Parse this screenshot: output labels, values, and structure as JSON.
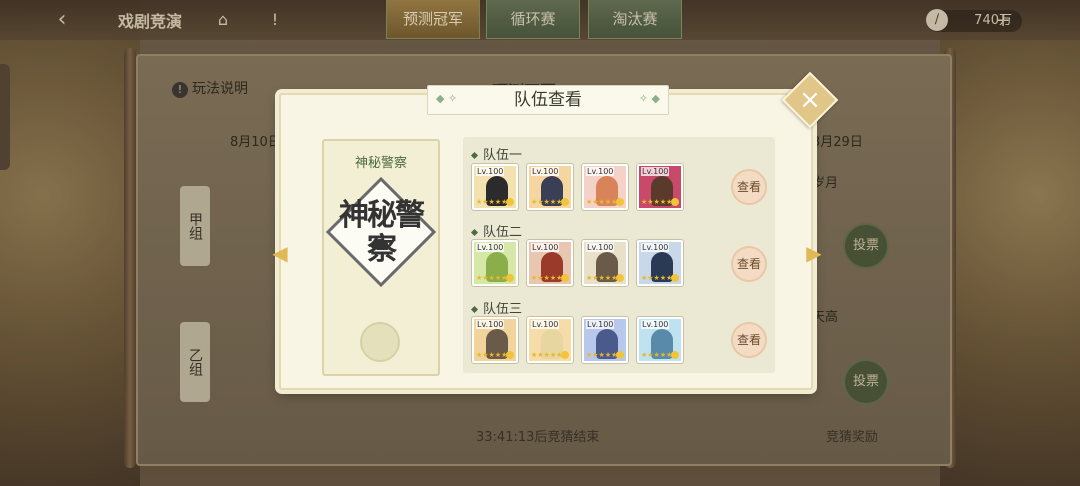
{
  "topbar": {
    "title": "戏剧竞演",
    "tabs": [
      "预测冠军",
      "循环赛",
      "淘汰赛"
    ],
    "currency": "740万",
    "icons": [
      "back-icon",
      "pavilion-icon",
      "alert-icon",
      "feather-coin-icon",
      "plus-icon"
    ]
  },
  "background_panel": {
    "help_label": "玩法说明",
    "title": "预测冠军",
    "date_left": "8月10日(",
    "date_right": "3月29日",
    "group_a": "甲组",
    "group_b": "乙组",
    "right_name_a": "岁月",
    "right_name_b": "天高",
    "vote_label": "投票",
    "timer": "33:41:13后竞猜结束",
    "reward": "竞猜奖励"
  },
  "modal": {
    "title": "队伍查看",
    "card_name": "神秘警察",
    "emblem_text": "神秘警察",
    "teams": [
      {
        "label": "队伍一",
        "members": [
          {
            "level": "Lv.100",
            "bg": "#f2e2b0",
            "fig": "#2b2b2b"
          },
          {
            "level": "Lv.100",
            "bg": "#f6d6a0",
            "fig": "#3a3f55"
          },
          {
            "level": "Lv.100",
            "bg": "#f5d2c8",
            "fig": "#d8835a"
          },
          {
            "level": "Lv.100",
            "bg": "#c9496a",
            "fig": "#5a3a2a"
          }
        ],
        "button": "查看"
      },
      {
        "label": "队伍二",
        "members": [
          {
            "level": "Lv.100",
            "bg": "#d6e8a8",
            "fig": "#8aae4a"
          },
          {
            "level": "Lv.100",
            "bg": "#e9c6b0",
            "fig": "#9a3a2a"
          },
          {
            "level": "Lv.100",
            "bg": "#e8e0c8",
            "fig": "#6a5a4a"
          },
          {
            "level": "Lv.100",
            "bg": "#c8d8e8",
            "fig": "#2a3a55"
          }
        ],
        "button": "查看"
      },
      {
        "label": "队伍三",
        "members": [
          {
            "level": "Lv.100",
            "bg": "#f0d49c",
            "fig": "#6a5a4a"
          },
          {
            "level": "Lv.100",
            "bg": "#f6dca8",
            "fig": "#e8d6a0"
          },
          {
            "level": "Lv.100",
            "bg": "#b8c8ec",
            "fig": "#4a5a8a"
          },
          {
            "level": "Lv.100",
            "bg": "#bfe2f0",
            "fig": "#5a8aaa"
          }
        ],
        "button": "查看"
      }
    ]
  }
}
